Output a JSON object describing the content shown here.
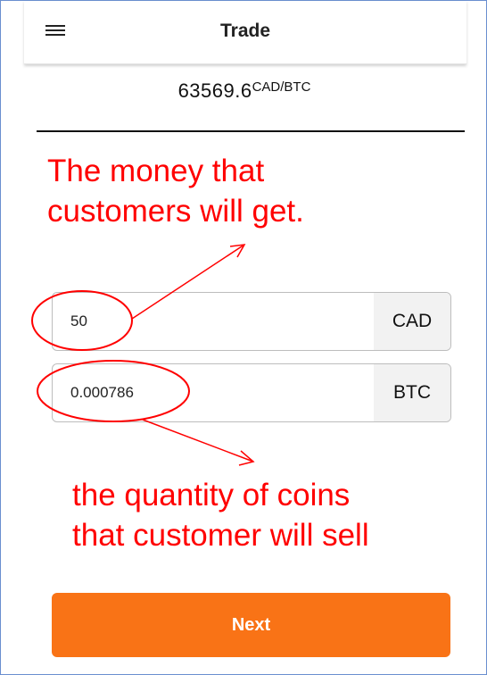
{
  "header": {
    "title": "Trade",
    "menu_icon": "hamburger-menu-icon"
  },
  "rate": {
    "value": "63569.6",
    "unit": "CAD/BTC"
  },
  "fields": {
    "cad": {
      "value": "50",
      "unit": "CAD"
    },
    "btc": {
      "value": "0.000786",
      "unit": "BTC"
    }
  },
  "annotations": {
    "top_line1": "The money that",
    "top_line2": "customers will get.",
    "bottom_line1": "the quantity of coins",
    "bottom_line2": "that customer will sell"
  },
  "next_button": {
    "label": "Next"
  },
  "colors": {
    "accent": "#f97316",
    "annotation": "#ff0000",
    "frame_border": "#6a8fd0"
  }
}
